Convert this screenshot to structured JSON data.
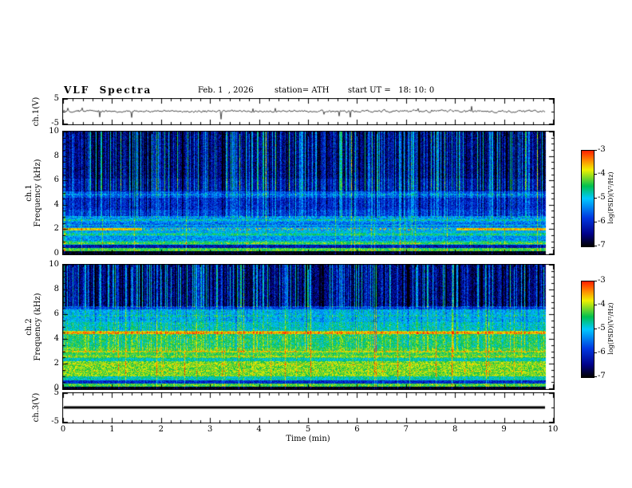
{
  "title": "VLF  Spectra",
  "header": {
    "date": "Feb. 1  , 2026",
    "station": "station= ATH",
    "start_ut": "start UT =   18: 10: 0"
  },
  "xaxis": {
    "label": "Time (min)",
    "lim": [
      0,
      10
    ],
    "ticks": [
      0,
      1,
      2,
      3,
      4,
      5,
      6,
      7,
      8,
      9,
      10
    ],
    "minor_step": 0.2,
    "data_end_min": 9.8
  },
  "colormap": {
    "positions": [
      0,
      0.13,
      0.3,
      0.5,
      0.63,
      0.8,
      0.9,
      1
    ],
    "colors": [
      "#000000",
      "#000089",
      "#0038e1",
      "#00c8ff",
      "#00c050",
      "#f0f000",
      "#ff8800",
      "#ff2000"
    ]
  },
  "chart_data": [
    {
      "type": "line",
      "name": "ch1_time_series",
      "ylabel": "ch.1(V)",
      "ylim": [
        -5,
        5
      ],
      "yticks": [
        5,
        -5
      ],
      "baseline_v": 0,
      "noise_amplitude_v": 1.5,
      "spike_depth_v": -3.5,
      "flat": false
    },
    {
      "type": "heatmap",
      "name": "ch1_spectrogram",
      "ylabel_lines": [
        "ch.1",
        "Frequency (kHz)"
      ],
      "ylim": [
        0,
        10
      ],
      "yticks": [
        0,
        2,
        4,
        6,
        8,
        10
      ],
      "zlabel": "log(PSD)(V²/Hz)",
      "zlim": [
        -7,
        -3
      ],
      "zticks": [
        -3,
        -4,
        -5,
        -6,
        -7
      ],
      "bands": [
        {
          "f0": 0.0,
          "f1": 0.22,
          "level": -7.0
        },
        {
          "f0": 0.22,
          "f1": 0.5,
          "level": -4.4
        },
        {
          "f0": 0.5,
          "f1": 0.72,
          "level": -6.2
        },
        {
          "f0": 0.72,
          "f1": 1.05,
          "level": -4.7
        },
        {
          "f0": 1.05,
          "f1": 1.45,
          "level": -5.3
        },
        {
          "f0": 1.45,
          "f1": 1.75,
          "level": -4.9
        },
        {
          "f0": 1.75,
          "f1": 2.2,
          "level": -5.1
        },
        {
          "f0": 2.2,
          "f1": 2.55,
          "level": -5.5
        },
        {
          "f0": 2.55,
          "f1": 3.1,
          "level": -5.3
        },
        {
          "f0": 3.1,
          "f1": 3.6,
          "level": -5.9
        },
        {
          "f0": 3.6,
          "f1": 4.6,
          "level": -6.1
        },
        {
          "f0": 4.6,
          "f1": 5.1,
          "level": -5.7
        },
        {
          "f0": 5.1,
          "f1": 6.2,
          "level": -6.3
        },
        {
          "f0": 6.2,
          "f1": 10.01,
          "level": -6.55
        }
      ],
      "lines": [
        {
          "f": 2.02,
          "w": 0.09,
          "level": -3.7,
          "edge": true
        },
        {
          "f": 0.88,
          "w": 0.05,
          "level": -4.3
        },
        {
          "f": 1.6,
          "w": 0.04,
          "level": -4.6
        },
        {
          "f": 2.35,
          "w": 0.05,
          "level": -4.9
        },
        {
          "f": 2.78,
          "w": 0.05,
          "level": -4.8
        },
        {
          "f": 4.85,
          "w": 0.06,
          "level": -5.4
        },
        {
          "f": 0.32,
          "w": 0.05,
          "level": -4.2
        }
      ],
      "streaks": {
        "density": 0.42,
        "strength": 2.1,
        "fmin": 5.2,
        "midFactor": 0.45
      }
    },
    {
      "type": "heatmap",
      "name": "ch2_spectrogram",
      "ylabel_lines": [
        "ch.2",
        "Frequency (kHz)"
      ],
      "ylim": [
        0,
        10
      ],
      "yticks": [
        0,
        2,
        4,
        6,
        8,
        10
      ],
      "zlabel": "log(PSD)(V²/Hz)",
      "zlim": [
        -7,
        -3
      ],
      "zticks": [
        -3,
        -4,
        -5,
        -6,
        -7
      ],
      "bands": [
        {
          "f0": 0.0,
          "f1": 0.18,
          "level": -7.0
        },
        {
          "f0": 0.18,
          "f1": 0.45,
          "level": -4.4
        },
        {
          "f0": 0.45,
          "f1": 0.7,
          "level": -6.0
        },
        {
          "f0": 0.7,
          "f1": 1.0,
          "level": -4.8
        },
        {
          "f0": 1.0,
          "f1": 2.25,
          "level": -4.15
        },
        {
          "f0": 2.25,
          "f1": 2.5,
          "level": -4.8
        },
        {
          "f0": 2.5,
          "f1": 3.35,
          "level": -4.35
        },
        {
          "f0": 3.35,
          "f1": 4.4,
          "level": -4.55
        },
        {
          "f0": 4.4,
          "f1": 4.65,
          "level": -4.0
        },
        {
          "f0": 4.65,
          "f1": 5.4,
          "level": -4.9
        },
        {
          "f0": 5.4,
          "f1": 6.4,
          "level": -5.15
        },
        {
          "f0": 6.4,
          "f1": 6.7,
          "level": -5.8
        },
        {
          "f0": 6.7,
          "f1": 10.01,
          "level": -6.5
        }
      ],
      "lines": [
        {
          "f": 4.52,
          "w": 0.08,
          "level": -3.6
        },
        {
          "f": 2.98,
          "w": 0.06,
          "level": -3.9
        },
        {
          "f": 2.6,
          "w": 0.05,
          "level": -4.1
        },
        {
          "f": 1.95,
          "w": 0.05,
          "level": -4.0
        },
        {
          "f": 1.42,
          "w": 0.06,
          "level": -3.9
        },
        {
          "f": 1.12,
          "w": 0.04,
          "level": -4.2
        },
        {
          "f": 0.3,
          "w": 0.06,
          "level": -4.3
        },
        {
          "f": 5.9,
          "w": 0.04,
          "level": -4.9
        }
      ],
      "streaks": {
        "density": 0.38,
        "strength": 1.9,
        "fmin": 6.6,
        "midFactor": 0.3
      }
    },
    {
      "type": "line",
      "name": "ch3_time_series",
      "ylabel": "ch.3(V)",
      "ylim": [
        -5,
        5
      ],
      "yticks": [
        5,
        -5
      ],
      "baseline_v": 0,
      "flat": true,
      "line_thickness": 3
    }
  ]
}
